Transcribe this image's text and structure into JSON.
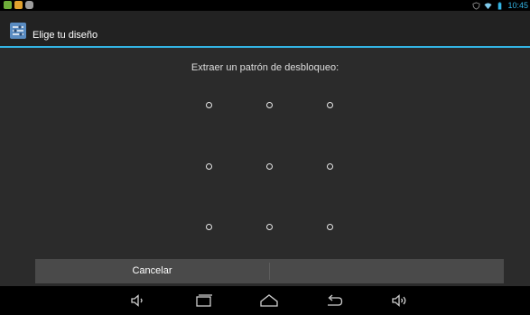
{
  "status_bar": {
    "time": "10:45",
    "notification_colors": [
      "#6fae3a",
      "#e0a12e",
      "#9d9d9d"
    ],
    "status_icons": [
      "shield-icon",
      "wifi-icon",
      "battery-icon"
    ]
  },
  "action_bar": {
    "icon": "pattern-settings-icon",
    "title": "Elige tu diseño",
    "accent_color": "#33b5e5"
  },
  "pattern": {
    "instruction": "Extraer un patrón de desbloqueo:",
    "rows": 3,
    "columns": 3
  },
  "buttons": {
    "cancel_label": "Cancelar",
    "continue_label": ""
  },
  "nav_bar": {
    "icons": [
      "volume-down-icon",
      "recent-apps-icon",
      "home-icon",
      "back-icon",
      "volume-up-icon"
    ]
  }
}
